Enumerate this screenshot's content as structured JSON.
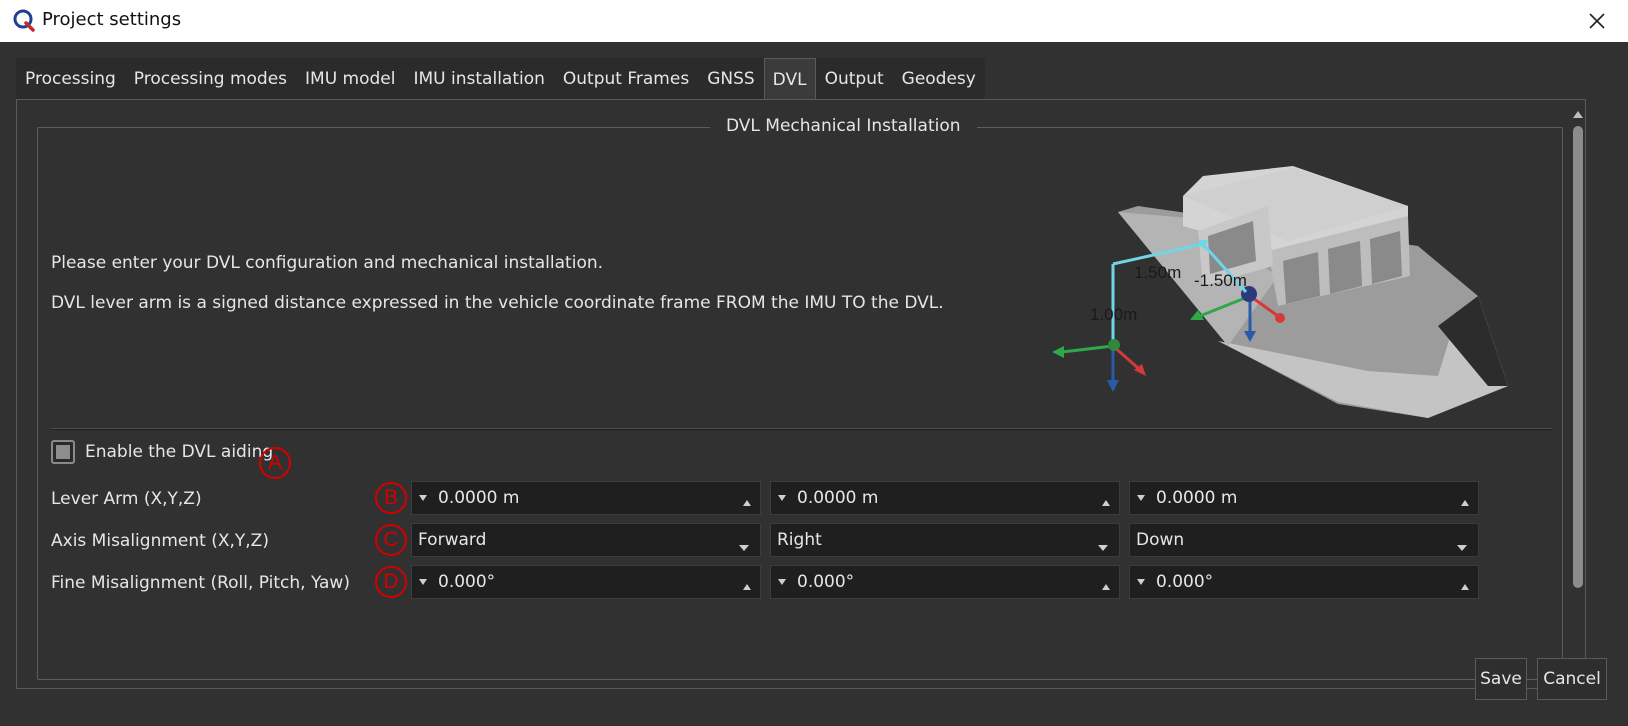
{
  "window": {
    "title": "Project settings",
    "app_icon": "q-logo-icon",
    "close_icon": "close-icon"
  },
  "tabs": [
    {
      "label": "Processing",
      "active": false
    },
    {
      "label": "Processing modes",
      "active": false
    },
    {
      "label": "IMU model",
      "active": false
    },
    {
      "label": "IMU installation",
      "active": false
    },
    {
      "label": "Output Frames",
      "active": false
    },
    {
      "label": "GNSS",
      "active": false
    },
    {
      "label": "DVL",
      "active": true
    },
    {
      "label": "Output",
      "active": false
    },
    {
      "label": "Geodesy",
      "active": false
    }
  ],
  "group": {
    "title": "DVL Mechanical Installation",
    "intro_line1": "Please enter your DVL configuration and mechanical installation.",
    "intro_line2": "DVL lever arm is a signed distance expressed in the vehicle coordinate frame FROM the IMU TO the DVL."
  },
  "diagram": {
    "label_x": "1.50m",
    "label_y": "-1.50m",
    "label_z": "1.00m",
    "axis_colors": {
      "x": "#d33a3a",
      "y": "#2fa84a",
      "z": "#2a5aa8",
      "lever": "#6fd6e6"
    }
  },
  "enable_aiding": {
    "label": "Enable the DVL aiding",
    "checked": false,
    "marker": "A"
  },
  "lever_arm": {
    "label": "Lever Arm (X,Y,Z)",
    "marker": "B",
    "values": [
      "0.0000 m",
      "0.0000 m",
      "0.0000 m"
    ]
  },
  "axis_misalignment": {
    "label": "Axis Misalignment (X,Y,Z)",
    "marker": "C",
    "values": [
      "Forward",
      "Right",
      "Down"
    ]
  },
  "fine_misalignment": {
    "label": "Fine Misalignment (Roll, Pitch, Yaw)",
    "marker": "D",
    "values": [
      "0.000°",
      "0.000°",
      "0.000°"
    ]
  },
  "buttons": {
    "save": "Save",
    "cancel": "Cancel"
  },
  "colors": {
    "background": "#313131",
    "field": "#1f1f1f",
    "marker": "#d40000"
  }
}
